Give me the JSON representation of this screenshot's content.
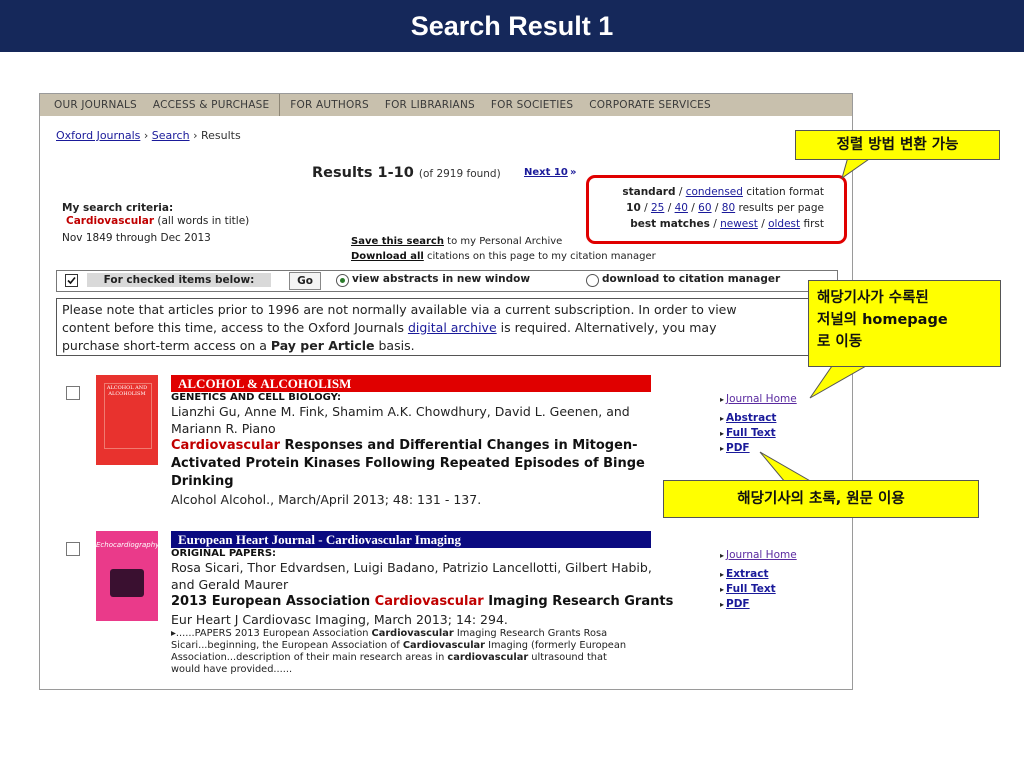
{
  "slide": {
    "title": "Search Result  1"
  },
  "nav": {
    "items": [
      "OUR JOURNALS",
      "ACCESS & PURCHASE",
      "FOR AUTHORS",
      "FOR LIBRARIANS",
      "FOR SOCIETIES",
      "CORPORATE SERVICES"
    ]
  },
  "breadcrumb": {
    "home": "Oxford Journals",
    "search": "Search",
    "sep": "›",
    "current": "Results"
  },
  "results": {
    "title": "Results 1-10",
    "found": "(of 2919 found)",
    "next": "Next 10",
    "next_arrow": "»"
  },
  "criteria": {
    "label": "My search criteria:",
    "term": "Cardiovascular",
    "scope": "(all words in title)",
    "range": "Nov 1849 through Dec 2013"
  },
  "sort": {
    "line1": {
      "standard": "standard",
      "slash": " / ",
      "condensed": "condensed",
      "tail": " citation format"
    },
    "line2": {
      "n10": "10",
      "n25": "25",
      "n40": "40",
      "n60": "60",
      "n80": "80",
      "tail": " results per page"
    },
    "line3": {
      "best": "best matches",
      "newest": "newest",
      "oldest": "oldest",
      "tail": " first"
    }
  },
  "save": {
    "save_link": "Save this search",
    "save_tail": " to my Personal Archive",
    "download_link": "Download all",
    "download_tail": " citations on this page to my citation manager"
  },
  "checked_bar": {
    "label": "For checked items below:",
    "go": "Go",
    "opt1": "view abstracts in new window",
    "opt2": "download to citation manager"
  },
  "notice": {
    "line1": "Please note that articles prior to 1996 are not normally available via a current subscription. In order to view",
    "line2a": "content before this time, access to the Oxford Journals ",
    "line2link": "digital archive",
    "line2b": " is required. Alternatively, you may",
    "line3a": "purchase short-term access on a ",
    "line3b": "Pay per Article",
    "line3c": " basis."
  },
  "result1": {
    "journal": "ALCOHOL & ALCOHOLISM",
    "cover_title": "ALCOHOL AND ALCOHOLISM",
    "section": "GENETICS AND CELL BIOLOGY:",
    "authors1": "Lianzhi Gu, Anne M. Fink, Shamim A.K. Chowdhury, David L. Geenen, and",
    "authors2": "Mariann R. Piano",
    "title_red": "Cardiovascular",
    "title1_rest": " Responses and Differential Changes in Mitogen-",
    "title2": "Activated Protein Kinases Following Repeated Episodes of Binge",
    "title3": "Drinking",
    "citation": "Alcohol Alcohol., March/April 2013; 48: 131 - 137.",
    "links": {
      "journal_home": "Journal Home",
      "abstract": "Abstract",
      "full_text": "Full Text",
      "pdf": "PDF"
    }
  },
  "result2": {
    "journal": "European Heart Journal - Cardiovascular Imaging",
    "cover_title": "Echocardiography",
    "section": "ORIGINAL PAPERS:",
    "authors1": "Rosa Sicari, Thor Edvardsen, Luigi Badano, Patrizio Lancellotti, Gilbert Habib,",
    "authors2": "and Gerald Maurer",
    "title_a": "2013 European Association ",
    "title_red": "Cardiovascular",
    "title_b": " Imaging Research Grants",
    "citation": "Eur Heart J Cardiovasc Imaging, March 2013; 14: 294.",
    "snip1_a": "▸......PAPERS 2013 European Association ",
    "snip1_b": "Cardiovascular",
    "snip1_c": " Imaging Research Grants Rosa",
    "snip2_a": "Sicari...beginning, the European Association of ",
    "snip2_b": "Cardiovascular",
    "snip2_c": " Imaging (formerly European",
    "snip3_a": "Association...description of their main research areas in ",
    "snip3_b": "cardiovascular",
    "snip3_c": " ultrasound that",
    "snip4": "would have provided......",
    "links": {
      "journal_home": "Journal Home",
      "extract": "Extract",
      "full_text": "Full Text",
      "pdf": "PDF"
    }
  },
  "callouts": {
    "sort": "정렬 방법 변환 가능",
    "journal_home_1": "해당기사가 수록된",
    "journal_home_2": "저널의 homepage",
    "journal_home_3": "로 이동",
    "fulltext": "해당기사의 초록, 원문 이용"
  },
  "colors": {
    "header_bg": "#15285a",
    "callout": "#ffff00",
    "highlight_frame": "#e00000",
    "nav_bg": "#c8c0ad"
  }
}
